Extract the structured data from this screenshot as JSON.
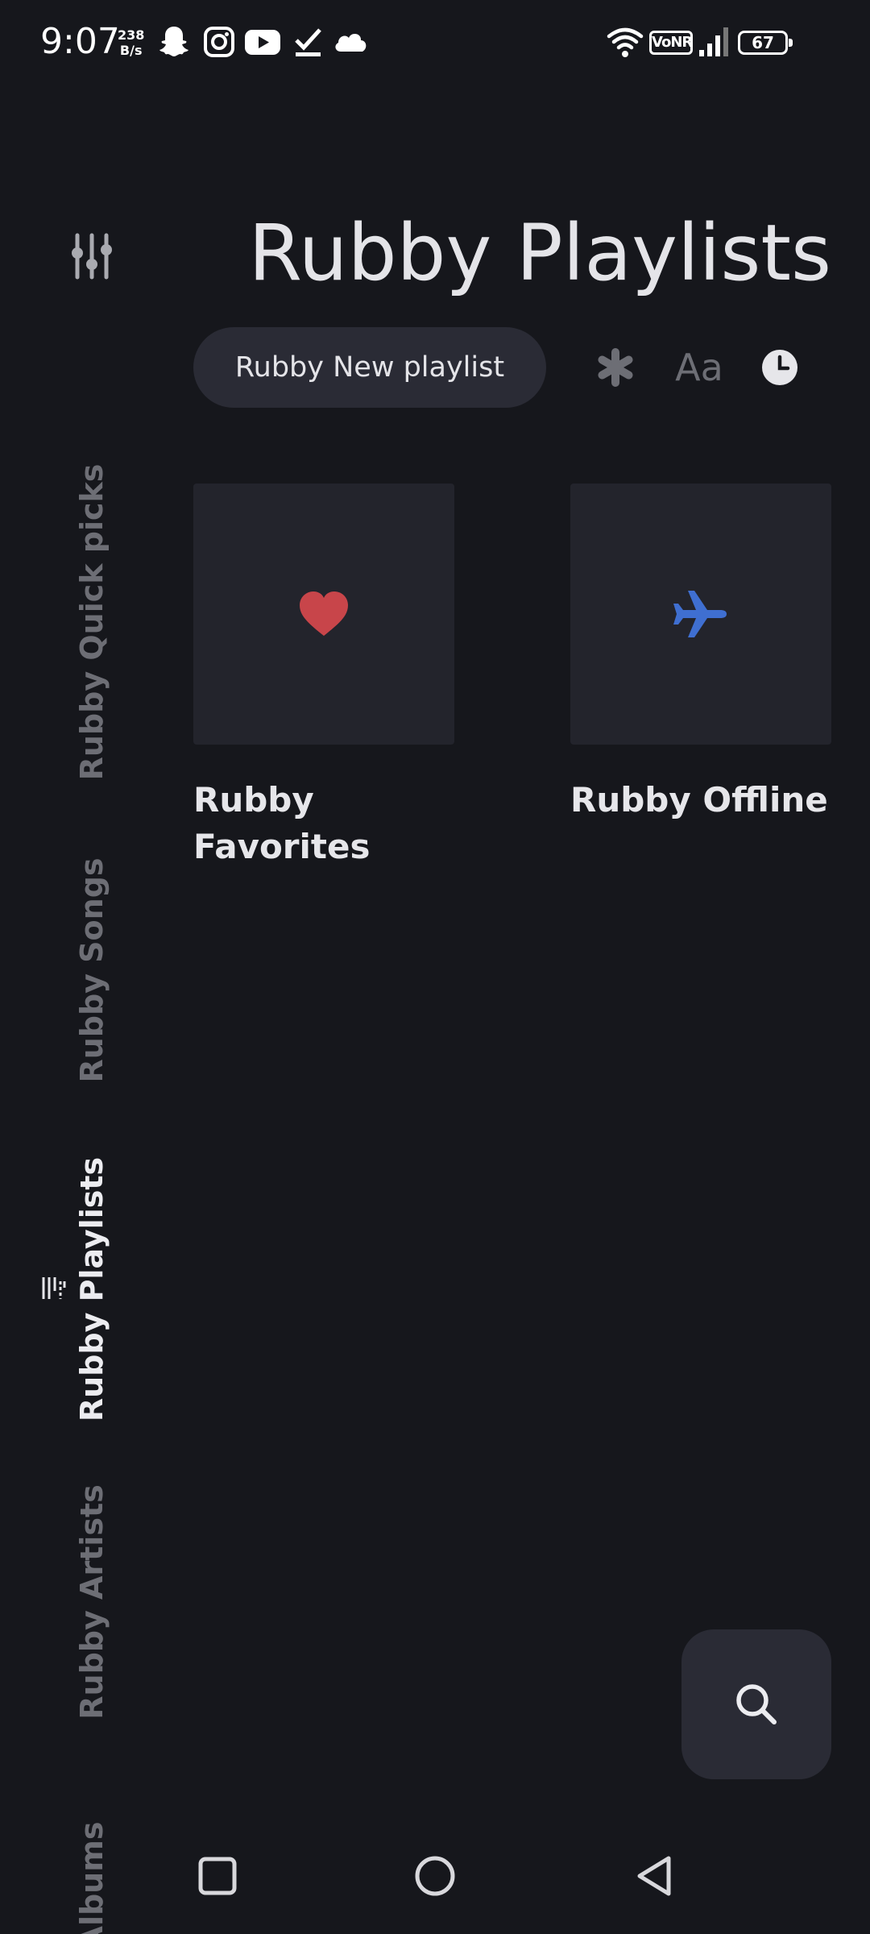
{
  "status_bar": {
    "time": "9:07",
    "net_speed_value": "238",
    "net_speed_unit": "B/s",
    "network_badge": "VoNR",
    "battery": "67",
    "icons": [
      "snapchat-icon",
      "instagram-icon",
      "youtube-icon",
      "check-icon",
      "cloud-icon",
      "wifi-icon",
      "signal-icon",
      "battery-icon"
    ]
  },
  "rail": {
    "settings_icon": "sliders-icon",
    "tabs": [
      {
        "label": "Rubby Quick picks",
        "active": false
      },
      {
        "label": "Rubby Songs",
        "active": false
      },
      {
        "label": "Rubby Playlists",
        "active": true
      },
      {
        "label": "Rubby Artists",
        "active": false
      },
      {
        "label": "Albums",
        "active": false
      }
    ]
  },
  "header": {
    "title": "Rubby Playlists",
    "new_playlist_label": "Rubby New playlist",
    "sort_options": [
      "asterisk-icon",
      "Aa",
      "clock-icon"
    ]
  },
  "playlists": [
    {
      "title": "Rubby Favorites",
      "icon": "heart-icon",
      "icon_color": "#c8454a"
    },
    {
      "title": "Rubby Offline",
      "icon": "airplane-icon",
      "icon_color": "#3f6fd1"
    }
  ],
  "fab": {
    "icon": "search-icon"
  },
  "nav_bar": {
    "icons": [
      "recents-square-icon",
      "home-circle-icon",
      "back-triangle-icon"
    ]
  },
  "colors": {
    "background": "#16171c",
    "surface": "#23242c",
    "pill": "#2a2b35",
    "inactive": "#6d6e75",
    "text": "#e6e6ea"
  }
}
